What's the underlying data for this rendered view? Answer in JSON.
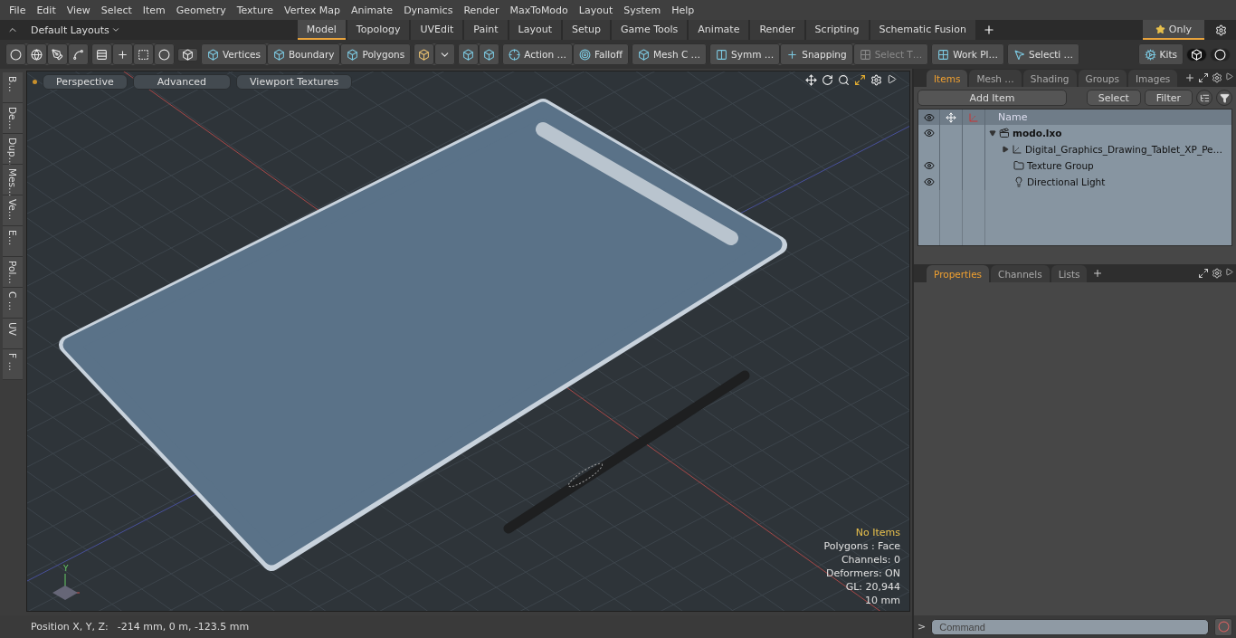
{
  "menu": [
    "File",
    "Edit",
    "View",
    "Select",
    "Item",
    "Geometry",
    "Texture",
    "Vertex Map",
    "Animate",
    "Dynamics",
    "Render",
    "MaxToModo",
    "Layout",
    "System",
    "Help"
  ],
  "layout_bar": {
    "preset": "Default Layouts",
    "tabs": [
      {
        "label": "Model",
        "selected": true
      },
      {
        "label": "Topology",
        "selected": false
      },
      {
        "label": "UVEdit",
        "selected": false
      },
      {
        "label": "Paint",
        "selected": false
      },
      {
        "label": "Layout",
        "selected": false
      },
      {
        "label": "Setup",
        "selected": false
      },
      {
        "label": "Game Tools",
        "selected": false
      },
      {
        "label": "Animate",
        "selected": false
      },
      {
        "label": "Render",
        "selected": false
      },
      {
        "label": "Scripting",
        "selected": false
      },
      {
        "label": "Schematic Fusion",
        "selected": false
      }
    ],
    "filter": {
      "label": "Only",
      "selected": true
    }
  },
  "toolbar": [
    {
      "label": "Vertices",
      "disabled": false
    },
    {
      "label": "Boundary",
      "disabled": false
    },
    {
      "label": "Polygons",
      "disabled": false
    },
    {
      "label": "Action …",
      "disabled": false
    },
    {
      "label": "Falloff",
      "disabled": false
    },
    {
      "label": "Mesh C …",
      "disabled": false
    },
    {
      "label": "Symm …",
      "disabled": false
    },
    {
      "label": "Snapping",
      "disabled": false
    },
    {
      "label": "Select T…",
      "disabled": true
    },
    {
      "label": "Work Pl…",
      "disabled": false
    },
    {
      "label": "Selecti …",
      "disabled": false
    },
    {
      "label": "Kits",
      "disabled": false
    }
  ],
  "left_tabs": [
    "B…",
    "De…",
    "Dup…",
    "Mes…",
    "Ve…",
    "E…",
    "Pol…",
    "C …",
    "UV",
    "F …"
  ],
  "viewport": {
    "buttons": [
      "Perspective",
      "Advanced",
      "Viewport Textures"
    ],
    "axis_label": "Y",
    "stats": [
      {
        "text": "No Items",
        "kind": "warning"
      },
      {
        "text": "Polygons : Face",
        "kind": "info"
      },
      {
        "text": "Channels: 0",
        "kind": "info"
      },
      {
        "text": "Deformers: ON",
        "kind": "info"
      },
      {
        "text": "GL: 20,944",
        "kind": "info"
      },
      {
        "text": "10 mm",
        "kind": "info"
      }
    ]
  },
  "status_bar": {
    "label": "Position X, Y, Z:",
    "value": "-214 mm, 0 m, -123.5 mm"
  },
  "items_panel": {
    "tabs": [
      {
        "label": "Items",
        "selected": true
      },
      {
        "label": "Mesh …",
        "selected": false
      },
      {
        "label": "Shading",
        "selected": false
      },
      {
        "label": "Groups",
        "selected": false
      },
      {
        "label": "Images",
        "selected": false
      }
    ],
    "add_item": "Add Item",
    "buttons": [
      "Select",
      "Filter"
    ],
    "name_column": "Name",
    "tree": [
      {
        "label": "modo.lxo",
        "kind": "scene",
        "visible": true,
        "expanded": true,
        "children": [
          {
            "label": "Digital_Graphics_Drawing_Tablet_XP_Pe…",
            "kind": "mesh",
            "visible": false,
            "expanded": false
          },
          {
            "label": "Texture Group",
            "kind": "group",
            "visible": true
          },
          {
            "label": "Directional Light",
            "kind": "light",
            "visible": true
          }
        ]
      }
    ]
  },
  "properties_panel": {
    "tabs": [
      {
        "label": "Properties",
        "selected": true
      },
      {
        "label": "Channels",
        "selected": false
      },
      {
        "label": "Lists",
        "selected": false
      }
    ]
  },
  "command": {
    "prompt": ">",
    "placeholder": "Command"
  }
}
